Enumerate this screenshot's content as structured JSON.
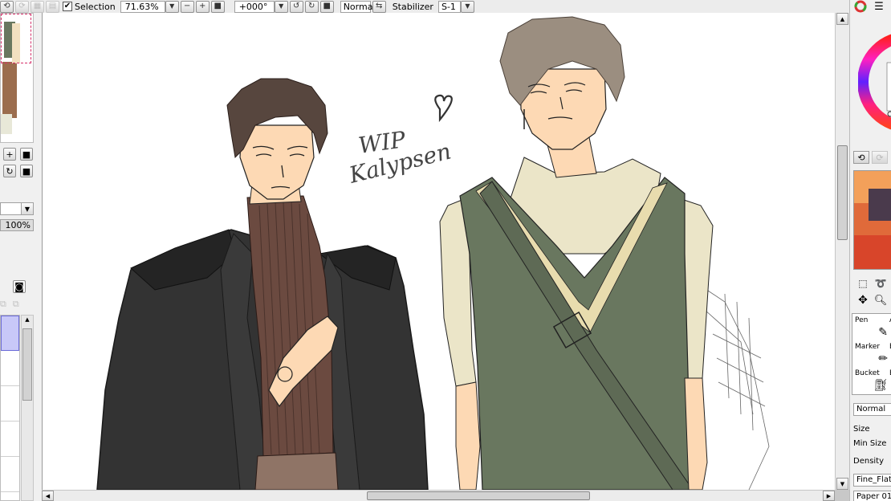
{
  "toolbar": {
    "undo_icon": "undo-icon",
    "redo_icon": "redo-icon",
    "deselect_icon": "deselect-icon",
    "invert_icon": "invert-selection-icon",
    "selection_label": "Selection",
    "selection_checked": true,
    "zoom_value": "71.63%",
    "rotation_value": "+000°",
    "blend_mode": "Normal",
    "stabilizer_label": "Stabilizer",
    "stabilizer_value": "S-1"
  },
  "left_panel": {
    "opacity_value": "100%"
  },
  "right_panel": {
    "tools": [
      {
        "label": "Pen",
        "icon": "pen-icon",
        "next_label": "A"
      },
      {
        "label": "Marker",
        "icon": "marker-icon",
        "next_label": "E"
      },
      {
        "label": "Bucket",
        "icon": "bucket-icon",
        "next_label": "B"
      }
    ],
    "blend_mode": "Normal",
    "size_label": "Size",
    "min_size_label": "Min Size",
    "density_label": "Density",
    "brush_shape": "Fine_Flat",
    "paper_texture": "Paper 01"
  },
  "canvas": {
    "annotation_line1": "WIP",
    "annotation_line2": "Kalypsen"
  },
  "colors": {
    "coat": "#333333",
    "turtleneck": "#6b4a40",
    "vest": "#69775f",
    "shirt": "#ebe5c8",
    "skin": "#fdd9b4",
    "hair_left": "#57463e",
    "hair_right": "#9b8e80",
    "trousers": "#8f7466",
    "vest_stripe": "#e8dcae"
  }
}
